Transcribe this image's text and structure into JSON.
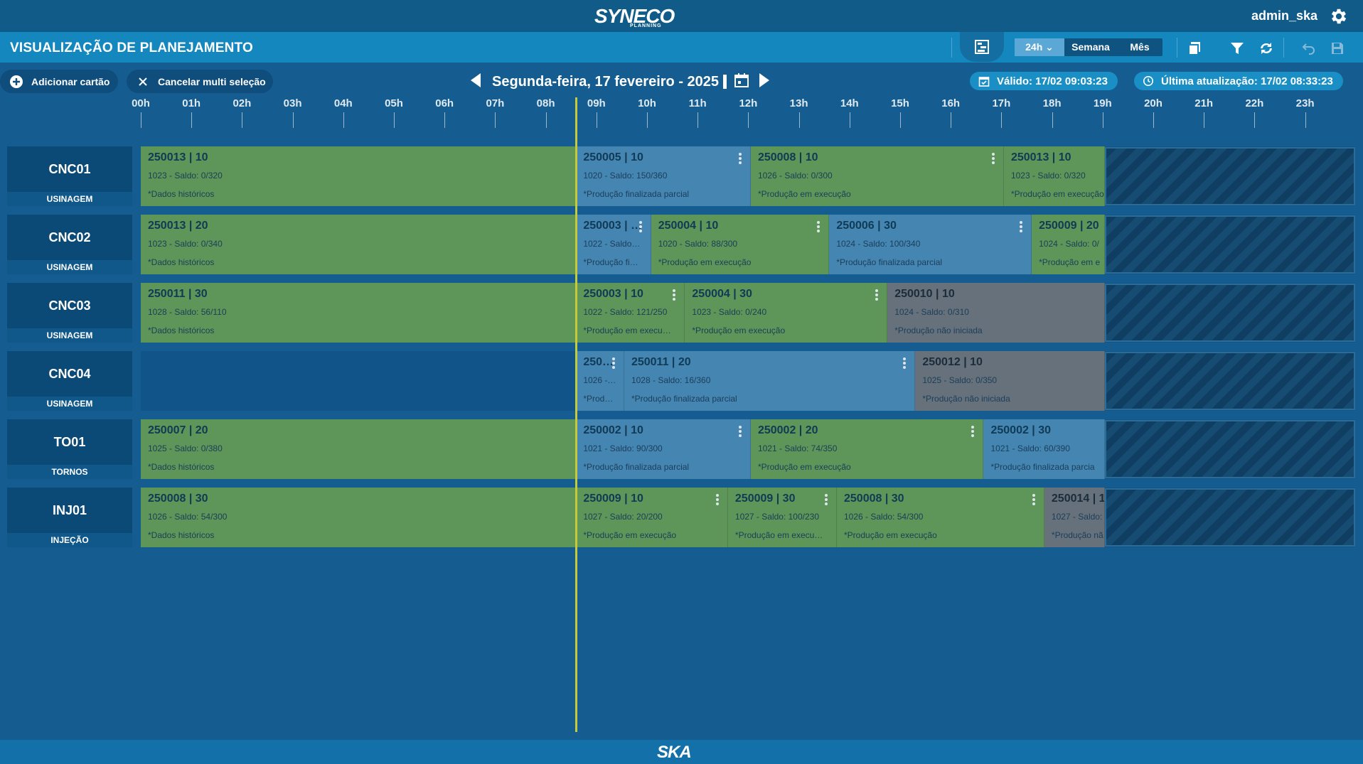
{
  "brand": {
    "name": "SYNECO",
    "sub": "PLANNING",
    "footer": "SKA"
  },
  "user": {
    "name": "admin_ska"
  },
  "header": {
    "title": "VISUALIZAÇÃO DE PLANEJAMENTO",
    "range_options": [
      "24h",
      "Semana",
      "Mês"
    ],
    "range_selected": "24h"
  },
  "actions": {
    "add_card": "Adicionar cartão",
    "cancel_multi": "Cancelar multi seleção"
  },
  "date_nav": {
    "label": "Segunda-feira, 17 fevereiro - 2025"
  },
  "status": {
    "valid": "Válido: 17/02 09:03:23",
    "last_update": "Última atualização: 17/02 08:33:23"
  },
  "timeline": {
    "hours": [
      "00h",
      "01h",
      "02h",
      "03h",
      "04h",
      "05h",
      "06h",
      "07h",
      "08h",
      "09h",
      "10h",
      "11h",
      "12h",
      "13h",
      "14h",
      "15h",
      "16h",
      "17h",
      "18h",
      "19h",
      "20h",
      "21h",
      "22h",
      "23h"
    ],
    "now_hour": 8.6
  },
  "colors": {
    "green": "#5d9658",
    "blue": "#4585b2",
    "gray": "#66717b",
    "now_line": "#c4ca3a"
  },
  "machines": [
    {
      "name": "CNC01",
      "group": "USINAGEM",
      "cards": [
        {
          "title": "250013 | 10",
          "detail": "1023 - Saldo: 0/320",
          "status": "*Dados históricos",
          "state": "green",
          "start": 0,
          "end": 8.6,
          "menu": false
        },
        {
          "title": "250005 | 10",
          "detail": "1020 - Saldo: 150/360",
          "status": "*Produção finalizada parcial",
          "state": "blue",
          "start": 8.6,
          "end": 12.05,
          "menu": true
        },
        {
          "title": "250008 | 10",
          "detail": "1026 - Saldo: 0/300",
          "status": "*Produção em execução",
          "state": "green",
          "start": 12.05,
          "end": 17.05,
          "menu": true
        },
        {
          "title": "250013 | 10",
          "detail": "1023 - Saldo: 0/320",
          "status": "*Produção em execução",
          "state": "green",
          "start": 17.05,
          "end": 19.05,
          "menu": false
        }
      ]
    },
    {
      "name": "CNC02",
      "group": "USINAGEM",
      "cards": [
        {
          "title": "250013 | 20",
          "detail": "1023 - Saldo: 0/340",
          "status": "*Dados históricos",
          "state": "green",
          "start": 0,
          "end": 8.6,
          "menu": false
        },
        {
          "title": "250003 | …",
          "detail": "1022 - Saldo…",
          "status": "*Produção fi…",
          "state": "blue",
          "start": 8.6,
          "end": 10.08,
          "menu": true
        },
        {
          "title": "250004 | 10",
          "detail": "1020 - Saldo: 88/300",
          "status": "*Produção em execução",
          "state": "green",
          "start": 10.08,
          "end": 13.6,
          "menu": true
        },
        {
          "title": "250006 | 30",
          "detail": "1024 - Saldo: 100/340",
          "status": "*Produção finalizada parcial",
          "state": "blue",
          "start": 13.6,
          "end": 17.6,
          "menu": true
        },
        {
          "title": "250009 | 20",
          "detail": "1024 - Saldo: 0/",
          "status": "*Produção em e",
          "state": "green",
          "start": 17.6,
          "end": 19.05,
          "menu": false
        }
      ]
    },
    {
      "name": "CNC03",
      "group": "USINAGEM",
      "cards": [
        {
          "title": "250011 | 30",
          "detail": "1028 - Saldo: 56/110",
          "status": "*Dados históricos",
          "state": "green",
          "start": 0,
          "end": 8.6,
          "menu": false
        },
        {
          "title": "250003 | 10",
          "detail": "1022 - Saldo: 121/250",
          "status": "*Produção em execu…",
          "state": "green",
          "start": 8.6,
          "end": 10.75,
          "menu": true
        },
        {
          "title": "250004 | 30",
          "detail": "1023 - Saldo: 0/240",
          "status": "*Produção em execução",
          "state": "green",
          "start": 10.75,
          "end": 14.75,
          "menu": true
        },
        {
          "title": "250010 | 10",
          "detail": "1024 - Saldo: 0/310",
          "status": "*Produção não iniciada",
          "state": "gray",
          "start": 14.75,
          "end": 19.05,
          "menu": false
        }
      ]
    },
    {
      "name": "CNC04",
      "group": "USINAGEM",
      "cards": [
        {
          "title": "250…",
          "detail": "1026 -…",
          "status": "*Prod…",
          "state": "blue",
          "start": 8.6,
          "end": 9.55,
          "menu": true
        },
        {
          "title": "250011 | 20",
          "detail": "1028 - Saldo: 16/360",
          "status": "*Produção finalizada parcial",
          "state": "blue",
          "start": 9.55,
          "end": 15.3,
          "menu": true
        },
        {
          "title": "250012 | 10",
          "detail": "1025 - Saldo: 0/350",
          "status": "*Produção não iniciada",
          "state": "gray",
          "start": 15.3,
          "end": 19.05,
          "menu": false
        }
      ]
    },
    {
      "name": "TO01",
      "group": "TORNOS",
      "cards": [
        {
          "title": "250007 | 20",
          "detail": "1025 - Saldo: 0/380",
          "status": "*Dados históricos",
          "state": "green",
          "start": 0,
          "end": 8.6,
          "menu": false
        },
        {
          "title": "250002 | 10",
          "detail": "1021 - Saldo: 90/300",
          "status": "*Produção finalizada parcial",
          "state": "blue",
          "start": 8.6,
          "end": 12.05,
          "menu": true
        },
        {
          "title": "250002 | 20",
          "detail": "1021 - Saldo: 74/350",
          "status": "*Produção em execução",
          "state": "green",
          "start": 12.05,
          "end": 16.65,
          "menu": true
        },
        {
          "title": "250002 | 30",
          "detail": "1021 - Saldo: 60/390",
          "status": "*Produção finalizada parcia",
          "state": "blue",
          "start": 16.65,
          "end": 19.05,
          "menu": false
        }
      ]
    },
    {
      "name": "INJ01",
      "group": "INJEÇÃO",
      "cards": [
        {
          "title": "250008 | 30",
          "detail": "1026 - Saldo: 54/300",
          "status": "*Dados históricos",
          "state": "green",
          "start": 0,
          "end": 8.6,
          "menu": false
        },
        {
          "title": "250009 | 10",
          "detail": "1027 - Saldo: 20/200",
          "status": "*Produção em execução",
          "state": "green",
          "start": 8.6,
          "end": 11.6,
          "menu": true
        },
        {
          "title": "250009 | 30",
          "detail": "1027 - Saldo: 100/230",
          "status": "*Produção em execu…",
          "state": "green",
          "start": 11.6,
          "end": 13.75,
          "menu": true
        },
        {
          "title": "250008 | 30",
          "detail": "1026 - Saldo: 54/300",
          "status": "*Produção em execução",
          "state": "green",
          "start": 13.75,
          "end": 17.85,
          "menu": true
        },
        {
          "title": "250014 | 1",
          "detail": "1027 - Saldo:",
          "status": "*Produção nã",
          "state": "gray",
          "start": 17.85,
          "end": 19.05,
          "menu": false
        }
      ]
    }
  ]
}
